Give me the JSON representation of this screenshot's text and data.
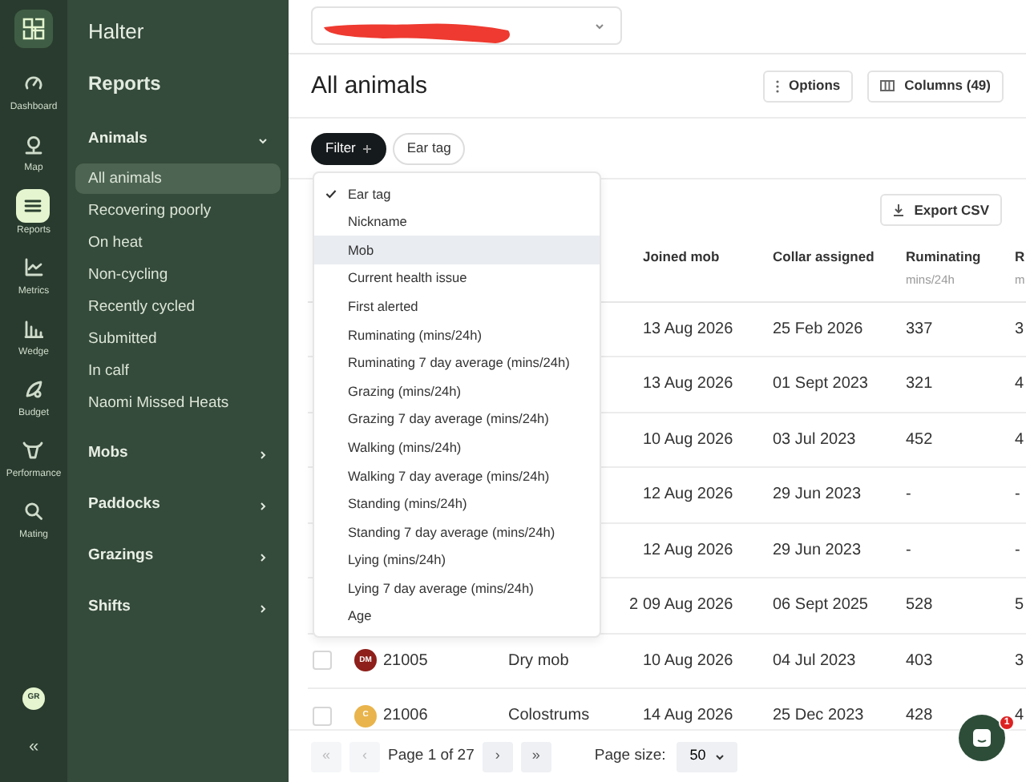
{
  "brand": "Halter",
  "rail": {
    "items": [
      {
        "label": "Dashboard",
        "selected": false
      },
      {
        "label": "Map",
        "selected": false
      },
      {
        "label": "Reports",
        "selected": true
      },
      {
        "label": "Metrics",
        "selected": false
      },
      {
        "label": "Wedge",
        "selected": false
      },
      {
        "label": "Budget",
        "selected": false
      },
      {
        "label": "Performance",
        "selected": false
      },
      {
        "label": "Mating",
        "selected": false
      }
    ],
    "avatar": "GR",
    "collapse": "«"
  },
  "sidebar": {
    "title": "Reports",
    "sections": [
      {
        "label": "Animals",
        "expanded": true,
        "items": [
          {
            "label": "All animals",
            "selected": true
          },
          {
            "label": "Recovering poorly",
            "selected": false
          },
          {
            "label": "On heat",
            "selected": false
          },
          {
            "label": "Non-cycling",
            "selected": false
          },
          {
            "label": "Recently cycled",
            "selected": false
          },
          {
            "label": "Submitted",
            "selected": false
          },
          {
            "label": "In calf",
            "selected": false
          },
          {
            "label": "Naomi Missed Heats",
            "selected": false
          }
        ]
      },
      {
        "label": "Mobs",
        "expanded": false
      },
      {
        "label": "Paddocks",
        "expanded": false
      },
      {
        "label": "Grazings",
        "expanded": false
      },
      {
        "label": "Shifts",
        "expanded": false
      }
    ]
  },
  "header": {
    "title": "All animals",
    "buttons": [
      "Options",
      "Columns (49)"
    ]
  },
  "filters": [
    {
      "label": "Filter",
      "kind": "add"
    },
    {
      "label": "Ear tag",
      "kind": "chip"
    }
  ],
  "export": "Export CSV",
  "column_menu": [
    {
      "label": "Ear tag",
      "checked": true,
      "selected": false
    },
    {
      "label": "Nickname",
      "checked": false,
      "selected": false
    },
    {
      "label": "Mob",
      "checked": false,
      "selected": true
    },
    {
      "label": "Current health issue",
      "checked": false,
      "selected": false
    },
    {
      "label": "First alerted",
      "checked": false,
      "selected": false
    },
    {
      "label": "Ruminating (mins/24h)",
      "checked": false,
      "selected": false
    },
    {
      "label": "Ruminating 7 day average (mins/24h)",
      "checked": false,
      "selected": false
    },
    {
      "label": "Grazing (mins/24h)",
      "checked": false,
      "selected": false
    },
    {
      "label": "Grazing 7 day average (mins/24h)",
      "checked": false,
      "selected": false
    },
    {
      "label": "Walking (mins/24h)",
      "checked": false,
      "selected": false
    },
    {
      "label": "Walking 7 day average (mins/24h)",
      "checked": false,
      "selected": false
    },
    {
      "label": "Standing (mins/24h)",
      "checked": false,
      "selected": false
    },
    {
      "label": "Standing 7 day average (mins/24h)",
      "checked": false,
      "selected": false
    },
    {
      "label": "Lying (mins/24h)",
      "checked": false,
      "selected": false
    },
    {
      "label": "Lying 7 day average (mins/24h)",
      "checked": false,
      "selected": false
    },
    {
      "label": "Age",
      "checked": false,
      "selected": false
    }
  ],
  "table": {
    "columns": [
      {
        "label": "Joined mob"
      },
      {
        "label": "Collar assigned"
      },
      {
        "label": "Ruminating",
        "unit": "mins/24h"
      },
      {
        "label": "R",
        "unit": "m"
      }
    ],
    "rows": [
      {
        "cells": [
          "13 Aug 2026",
          "25 Feb 2026",
          "337",
          "3"
        ]
      },
      {
        "cells": [
          "13 Aug 2026",
          "01 Sept 2023",
          "321",
          "4"
        ]
      },
      {
        "cells": [
          "10 Aug 2026",
          "03 Jul 2023",
          "452",
          "4"
        ]
      },
      {
        "cells": [
          "12 Aug 2026",
          "29 Jun 2023",
          "-",
          "-"
        ]
      },
      {
        "cells": [
          "12 Aug 2026",
          "29 Jun 2023",
          "-",
          "-"
        ]
      },
      {
        "mob": "2",
        "cells": [
          "09 Aug 2026",
          "06 Sept 2025",
          "528",
          "5"
        ]
      },
      {
        "checked": false,
        "avatar": "DM",
        "color": "#8e1f1a",
        "ear_tag": "21005",
        "mob": "Dry mob",
        "cells": [
          "10 Aug 2026",
          "04 Jul 2023",
          "403",
          "3"
        ]
      },
      {
        "checked": false,
        "avatar": "C",
        "color": "#e9b44c",
        "ear_tag": "21006",
        "mob": "Colostrums",
        "cells": [
          "14 Aug 2026",
          "25 Dec 2023",
          "428",
          "4"
        ]
      }
    ]
  },
  "pagination": {
    "first": "«",
    "prev": "‹",
    "first_disabled": true,
    "prev_disabled": true,
    "page": "Page 1 of 27",
    "next": "›",
    "last": "»",
    "size_label": "Page size:",
    "size": "50"
  },
  "chat": {
    "badge": "1"
  }
}
